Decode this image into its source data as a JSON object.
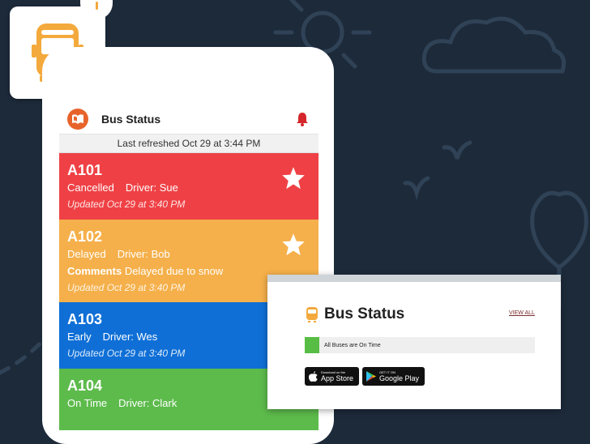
{
  "app": {
    "title": "Bus Status",
    "last_refreshed": "Last refreshed Oct 29 at 3:44 PM"
  },
  "buses": [
    {
      "route": "A101",
      "status": "Cancelled",
      "driver": "Driver: Sue",
      "comments_label": "",
      "comments": "",
      "updated": "Updated Oct 29 at 3:40 PM",
      "color": "#ef4145",
      "starred": true
    },
    {
      "route": "A102",
      "status": "Delayed",
      "driver": "Driver: Bob",
      "comments_label": "Comments",
      "comments": "Delayed due to snow",
      "updated": "Updated Oct 29 at 3:40 PM",
      "color": "#f5b04b",
      "starred": true
    },
    {
      "route": "A103",
      "status": "Early",
      "driver": "Driver: Wes",
      "comments_label": "",
      "comments": "",
      "updated": "Updated Oct 29 at 3:40 PM",
      "color": "#0f6fd6",
      "starred": false
    },
    {
      "route": "A104",
      "status": "On Time",
      "driver": "Driver: Clark",
      "comments_label": "",
      "comments": "",
      "updated": "",
      "color": "#5dbb4c",
      "starred": false
    }
  ],
  "widget": {
    "title": "Bus Status",
    "view_all": "VIEW ALL",
    "status_text": "All Buses are On Time",
    "app_store": {
      "small": "Download on the",
      "large": "App Store"
    },
    "google_play": {
      "small": "GET IT ON",
      "large": "Google Play"
    }
  },
  "colors": {
    "background": "#1d2a3a",
    "accent_orange": "#f3a93c",
    "bell_red": "#d4262b",
    "on_time_green": "#57bd44"
  }
}
